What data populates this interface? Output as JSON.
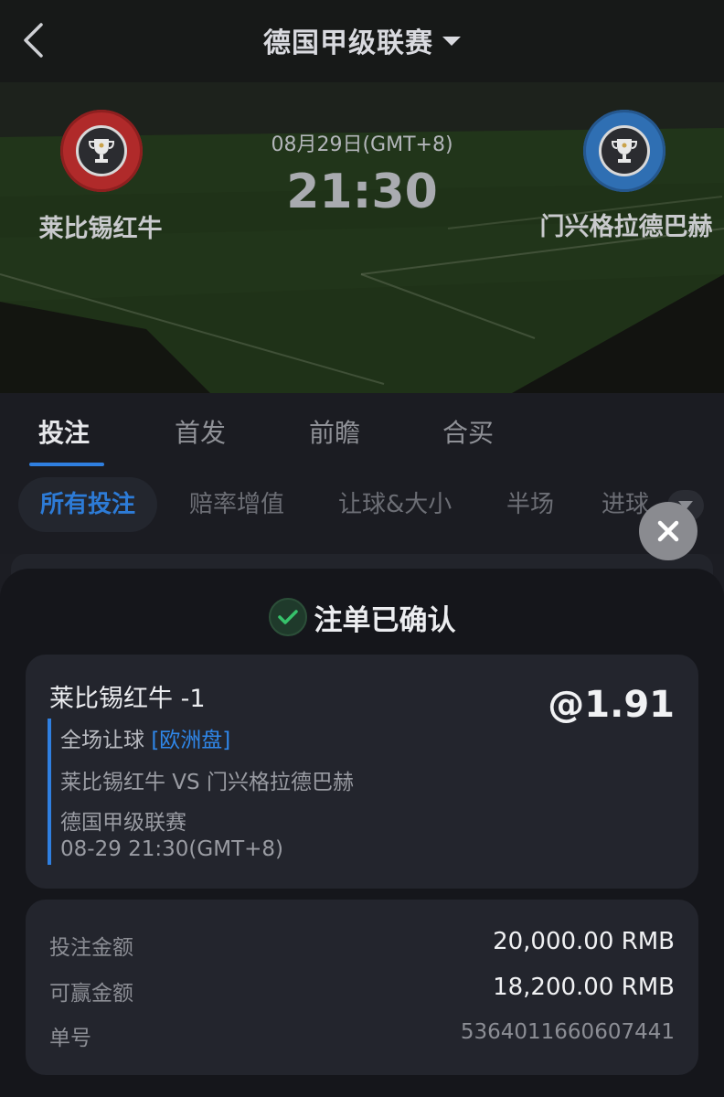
{
  "header": {
    "league": "德国甲级联赛",
    "home_team": "莱比锡红牛",
    "away_team": "门兴格拉德巴赫",
    "date": "08月29日(GMT+8)",
    "time": "21:30"
  },
  "tabs": [
    {
      "label": "投注",
      "active": true
    },
    {
      "label": "首发",
      "active": false
    },
    {
      "label": "前瞻",
      "active": false
    },
    {
      "label": "合买",
      "active": false
    }
  ],
  "subtabs": [
    {
      "label": "所有投注",
      "active": true
    },
    {
      "label": "赔率增值",
      "active": false
    },
    {
      "label": "让球&大小",
      "active": false
    },
    {
      "label": "半场",
      "active": false
    },
    {
      "label": "进球",
      "active": false
    }
  ],
  "confirmation": {
    "title": "注单已确认"
  },
  "bet": {
    "selection": "莱比锡红牛 -1",
    "odds": "@1.91",
    "market": "全场让球",
    "market_tag": "[欧洲盘]",
    "matchup": "莱比锡红牛 VS 门兴格拉德巴赫",
    "league": "德国甲级联赛",
    "kickoff": "08-29 21:30(GMT+8)"
  },
  "summary": {
    "stake_label": "投注金额",
    "stake_value": "20,000.00 RMB",
    "win_label": "可赢金额",
    "win_value": "18,200.00 RMB",
    "order_label": "单号",
    "order_value": "5364011660607441"
  },
  "colors": {
    "accent_blue": "#2f7fe0",
    "success_green": "#36c26b",
    "home_badge": "#b02a2a",
    "away_badge": "#2f6fb3"
  },
  "icons": {
    "back": "chevron-left-icon",
    "dropdown": "caret-down-icon",
    "close": "close-icon",
    "confirmed": "check-icon",
    "trophy": "trophy-icon"
  }
}
